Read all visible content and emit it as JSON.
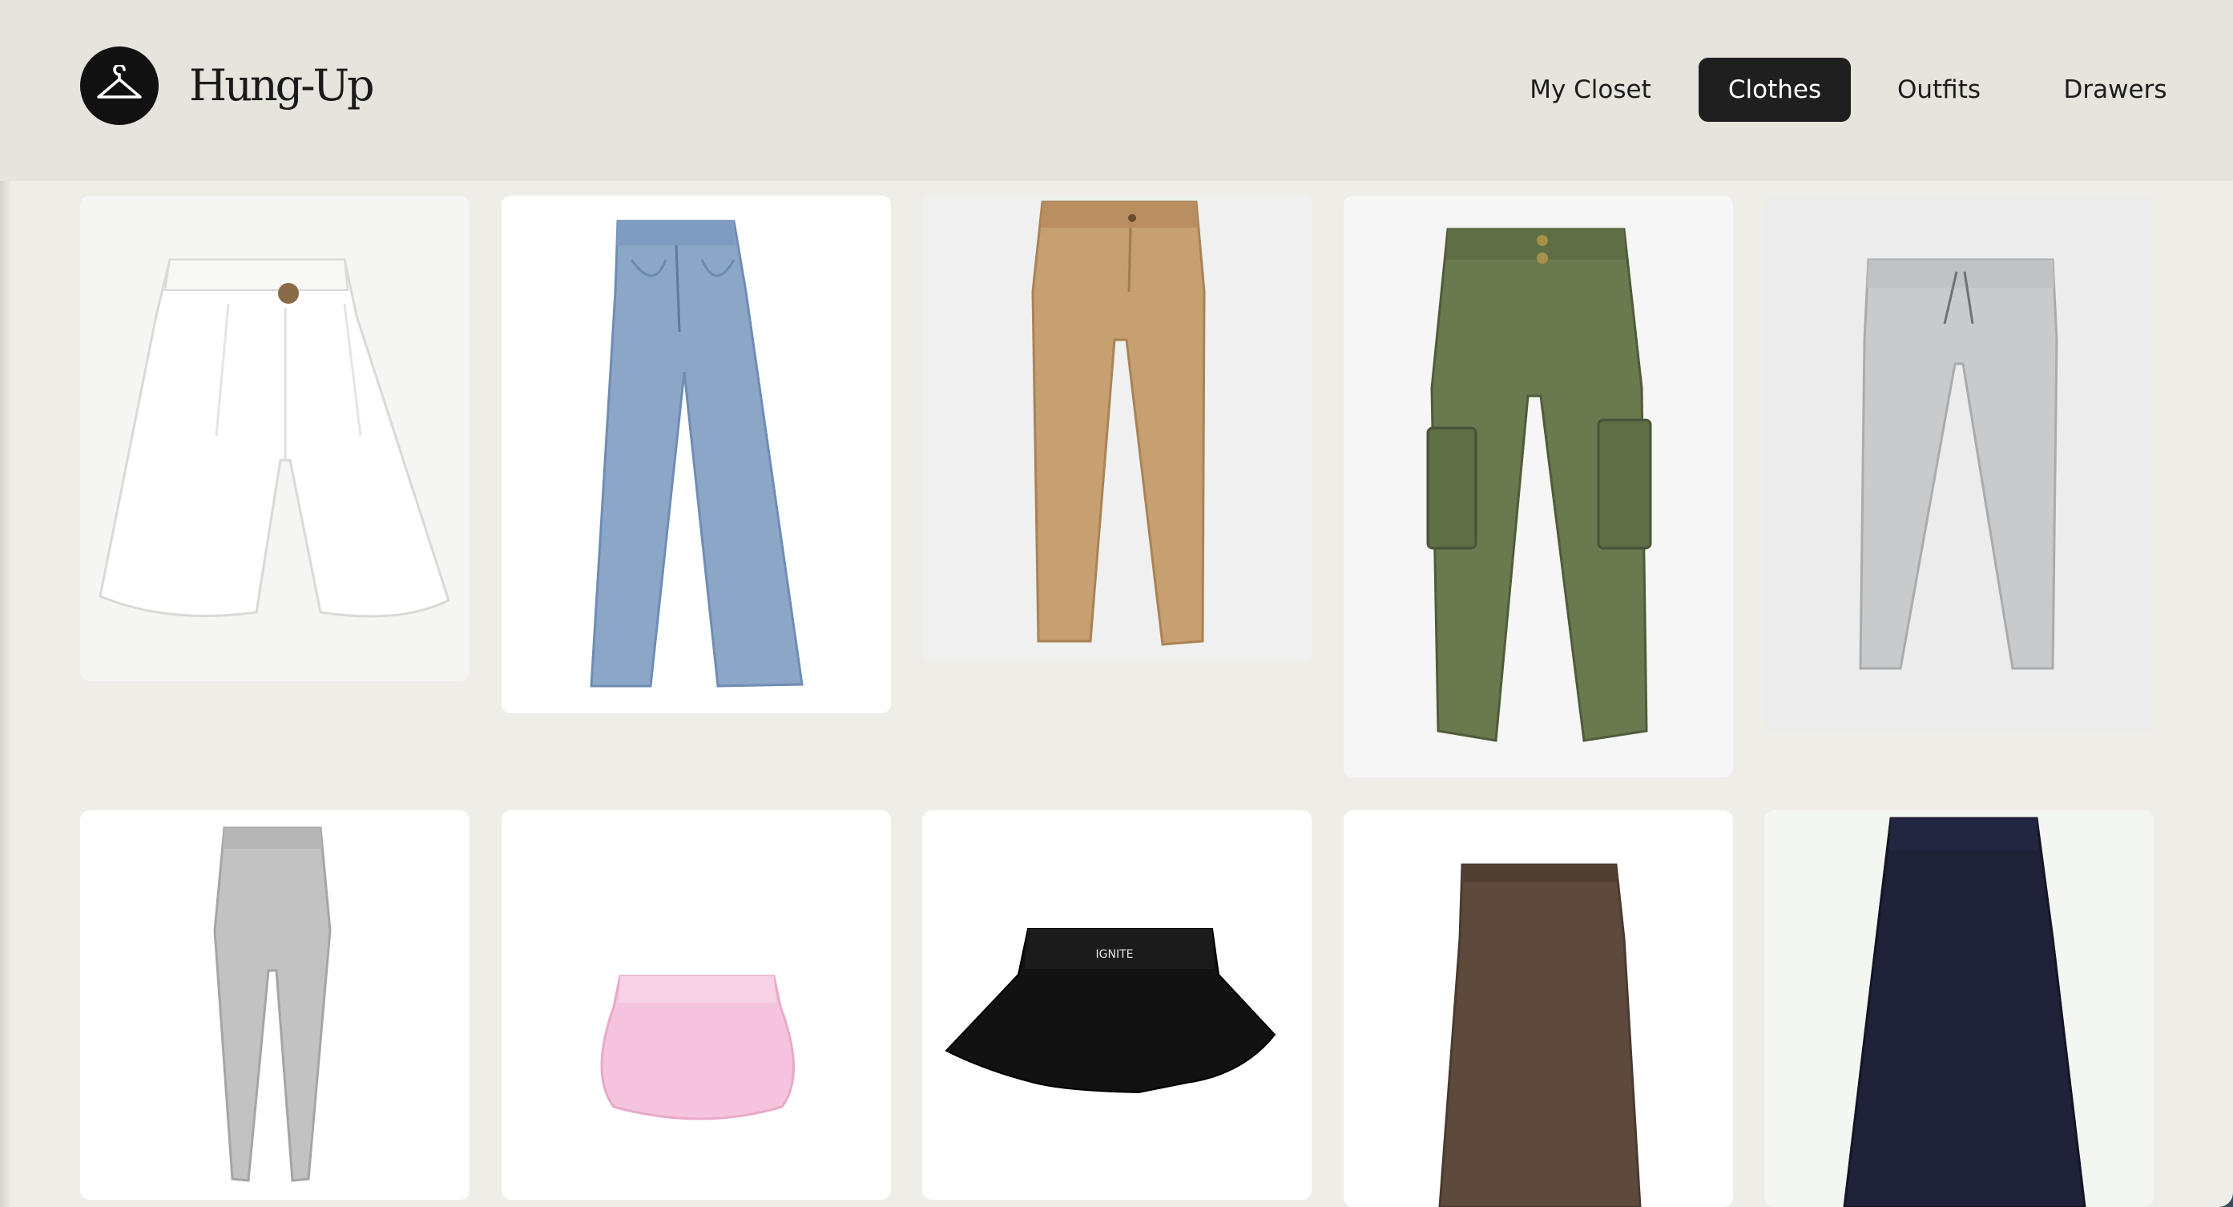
{
  "app": {
    "brand": "Hung-Up"
  },
  "nav": {
    "items": [
      {
        "label": "My Closet",
        "active": false
      },
      {
        "label": "Clothes",
        "active": true
      },
      {
        "label": "Outfits",
        "active": false
      },
      {
        "label": "Drawers",
        "active": false
      }
    ]
  },
  "clothes": {
    "items": [
      {
        "name": "white-shorts",
        "label": "IGNITE"
      }
    ],
    "skirt_text": "IGNITE"
  },
  "colors": {
    "header_bg": "#e7e4dd",
    "page_bg": "#efede8",
    "nav_active_bg": "#1f1f1f",
    "shorts": "#f3f2f0",
    "jeans": "#8fa8c8",
    "khakis": "#c29a6c",
    "cargo": "#66744a",
    "sweatpants": "#c4c6c9",
    "leggings": "#bdbdbd",
    "pink_skirt": "#f3c3dc",
    "black_skirt": "#111111",
    "brown_skirt": "#5f4a3c",
    "navy_skirt": "#1f2238"
  }
}
